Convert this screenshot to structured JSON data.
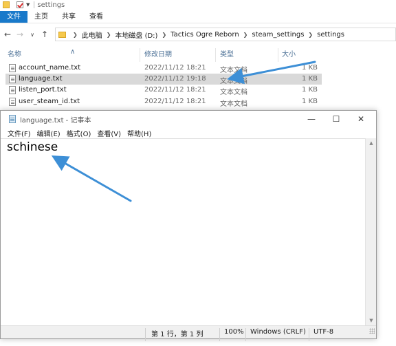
{
  "explorer": {
    "window_title": "settings",
    "ribbon_tabs": [
      "文件",
      "主页",
      "共享",
      "查看"
    ],
    "breadcrumb": [
      "此电脑",
      "本地磁盘 (D:)",
      "Tactics Ogre Reborn",
      "steam_settings",
      "settings"
    ],
    "columns": {
      "name": "名称",
      "date": "修改日期",
      "type": "类型",
      "size": "大小"
    },
    "files": [
      {
        "name": "account_name.txt",
        "date": "2022/11/12 18:21",
        "type": "文本文档",
        "size": "1 KB",
        "selected": false
      },
      {
        "name": "language.txt",
        "date": "2022/11/12 19:18",
        "type": "文本文档",
        "size": "1 KB",
        "selected": true
      },
      {
        "name": "listen_port.txt",
        "date": "2022/11/12 18:21",
        "type": "文本文档",
        "size": "1 KB",
        "selected": false
      },
      {
        "name": "user_steam_id.txt",
        "date": "2022/11/12 18:21",
        "type": "文本文档",
        "size": "1 KB",
        "selected": false
      }
    ]
  },
  "notepad": {
    "title": "language.txt - 记事本",
    "menu": [
      "文件(F)",
      "编辑(E)",
      "格式(O)",
      "查看(V)",
      "帮助(H)"
    ],
    "content": "schinese",
    "status": {
      "position": "第 1 行，第 1 列",
      "zoom": "100%",
      "line_ending": "Windows (CRLF)",
      "encoding": "UTF-8"
    }
  },
  "colors": {
    "accent": "#1979ca",
    "arrow": "#3d8fd6",
    "selection": "#d9d9d9"
  },
  "icons": [
    "folder-icon",
    "checkmark-icon",
    "back-arrow-icon",
    "forward-arrow-icon",
    "up-arrow-icon",
    "text-file-icon",
    "notepad-icon",
    "minimize-icon",
    "maximize-icon",
    "close-icon"
  ]
}
